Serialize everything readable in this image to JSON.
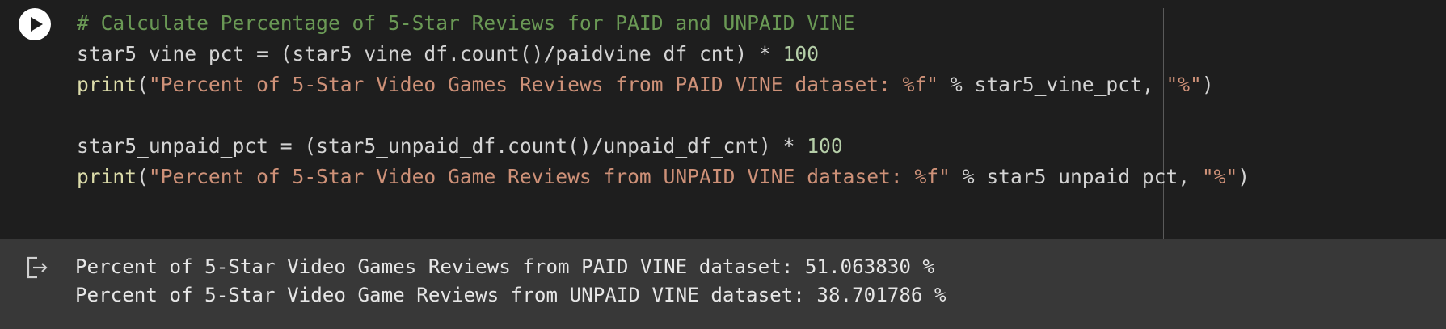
{
  "code": {
    "lines": [
      [
        {
          "text": "# Calculate Percentage of 5-Star Reviews for PAID and UNPAID VINE",
          "kind": "comment"
        }
      ],
      [
        {
          "text": "star5_vine_pct = (star5_vine_df.count()/paidvine_df_cnt) * ",
          "kind": "plain"
        },
        {
          "text": "100",
          "kind": "number"
        }
      ],
      [
        {
          "text": "print",
          "kind": "func"
        },
        {
          "text": "(",
          "kind": "plain"
        },
        {
          "text": "\"Percent of 5-Star Video Games Reviews from PAID VINE dataset: %f\"",
          "kind": "string"
        },
        {
          "text": " % star5_vine_pct, ",
          "kind": "plain"
        },
        {
          "text": "\"%\"",
          "kind": "string"
        },
        {
          "text": ")",
          "kind": "plain"
        }
      ],
      [],
      [
        {
          "text": "star5_unpaid_pct = (star5_unpaid_df.count()/unpaid_df_cnt) * ",
          "kind": "plain"
        },
        {
          "text": "100",
          "kind": "number"
        }
      ],
      [
        {
          "text": "print",
          "kind": "func"
        },
        {
          "text": "(",
          "kind": "plain"
        },
        {
          "text": "\"Percent of 5-Star Video Game Reviews from UNPAID VINE dataset: %f\"",
          "kind": "string"
        },
        {
          "text": " % star5_unpaid_pct, ",
          "kind": "plain"
        },
        {
          "text": "\"%\"",
          "kind": "string"
        },
        {
          "text": ")",
          "kind": "plain"
        }
      ]
    ]
  },
  "output": {
    "lines": [
      "Percent of 5-Star Video Games Reviews from PAID VINE dataset: 51.063830 %",
      "Percent of 5-Star Video Game Reviews from UNPAID VINE dataset: 38.701786 %"
    ]
  },
  "icons": {
    "run": "play-icon",
    "output": "output-exit-icon"
  },
  "colors": {
    "code_background": "#1e1e1e",
    "output_background": "#383838",
    "comment": "#6a9955",
    "function": "#dcdcaa",
    "string": "#ce9178",
    "number": "#b5cea8",
    "plain": "#d4d4d4"
  }
}
